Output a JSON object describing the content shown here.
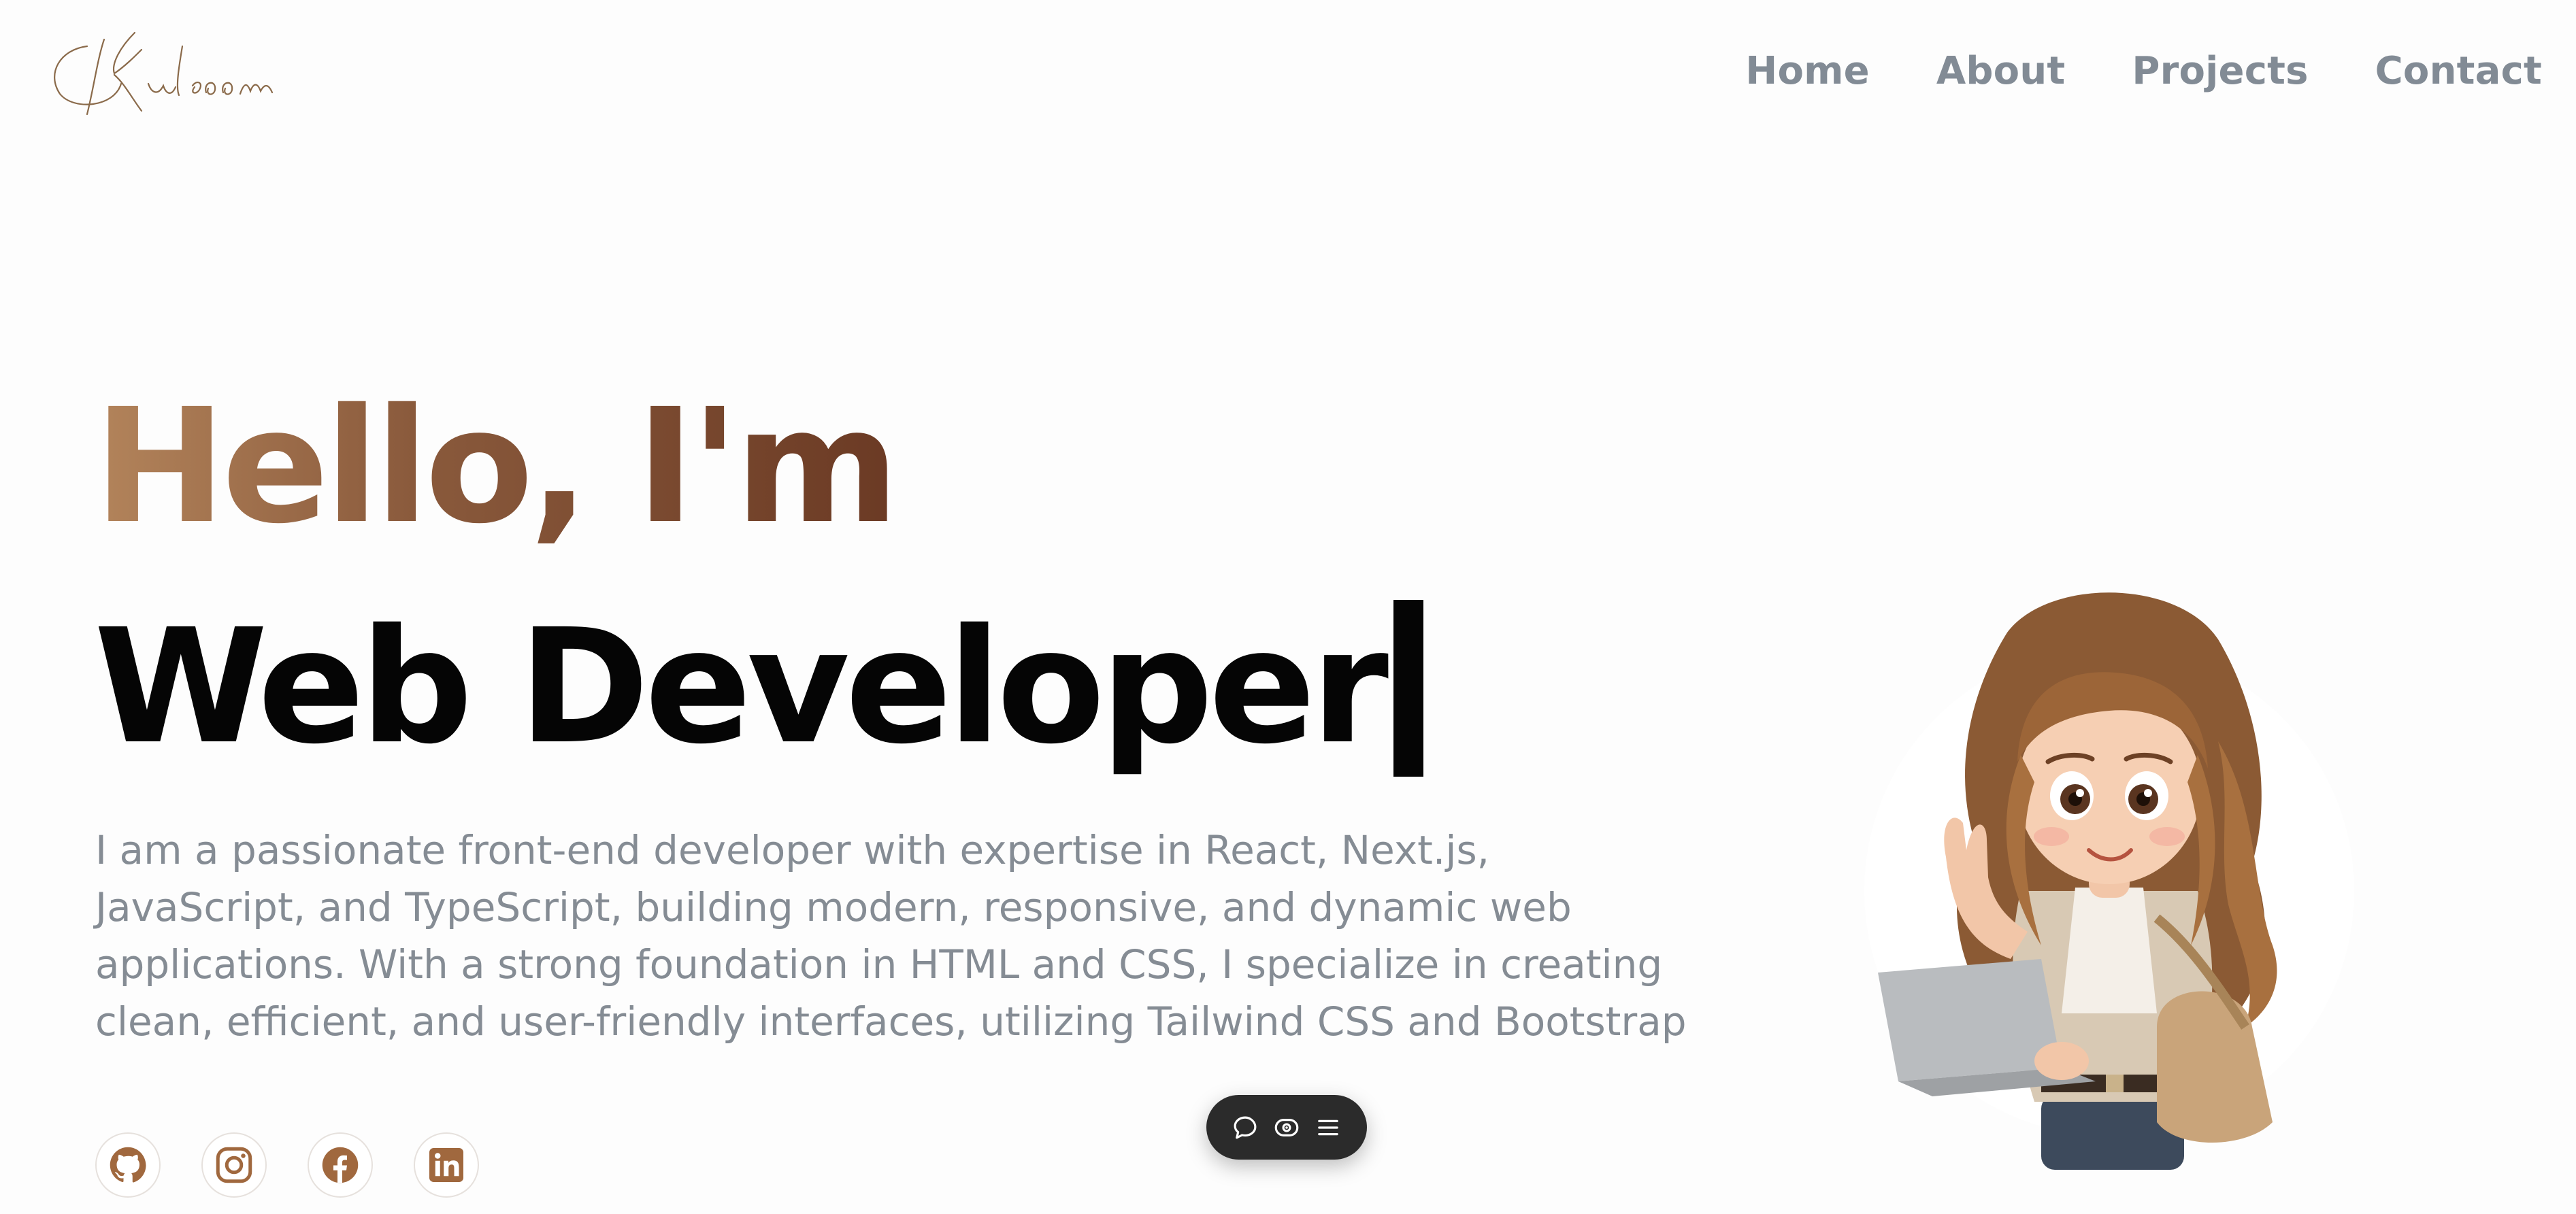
{
  "header": {
    "logo_text": "Kulsoom",
    "nav": [
      {
        "label": "Home"
      },
      {
        "label": "About"
      },
      {
        "label": "Projects"
      },
      {
        "label": "Contact"
      }
    ]
  },
  "hero": {
    "greeting": "Hello, I'm",
    "role": "Web Developer",
    "intro": "I am a passionate front-end developer with expertise in React, Next.js, JavaScript, and TypeScript, building modern, responsive, and dynamic web applications. With a strong foundation in HTML and CSS, I specialize in creating clean, efficient, and user-friendly interfaces, utilizing Tailwind CSS and Bootstrap"
  },
  "socials": [
    {
      "icon": "github-icon"
    },
    {
      "icon": "instagram-icon"
    },
    {
      "icon": "facebook-icon"
    },
    {
      "icon": "linkedin-icon"
    }
  ],
  "toolbar": [
    {
      "icon": "comment-icon"
    },
    {
      "icon": "preview-icon"
    },
    {
      "icon": "menu-icon"
    }
  ],
  "colors": {
    "accent": "#a0683e",
    "gradient_start": "#b3845b",
    "gradient_end": "#6b3a24",
    "nav_text": "#828b95",
    "body_text": "#858c94"
  }
}
